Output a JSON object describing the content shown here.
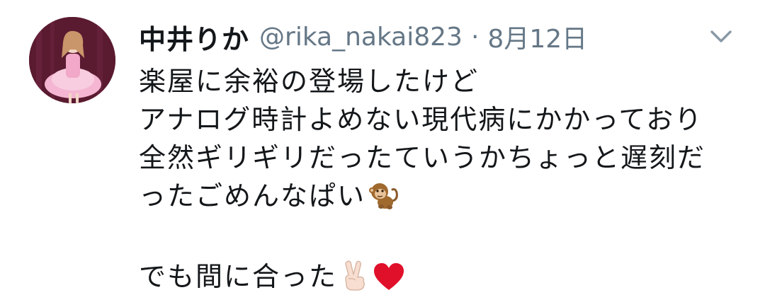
{
  "tweet": {
    "author_name": "中井りか",
    "handle": "@rika_nakai823",
    "separator": "·",
    "date": "8月12日",
    "lines": [
      "楽屋に余裕の登場したけど",
      "アナログ時計よめない現代病にかかっており",
      "全然ギリギリだったていうかちょっと遅刻だ",
      "ったごめんなぱい"
    ],
    "last_line": "でも間に合った",
    "emojis": [
      "monkey-emoji",
      "victory-hand-emoji",
      "red-heart-emoji"
    ],
    "colors": {
      "text": "#14171a",
      "secondary": "#657786",
      "heart": "#e0102a"
    }
  }
}
